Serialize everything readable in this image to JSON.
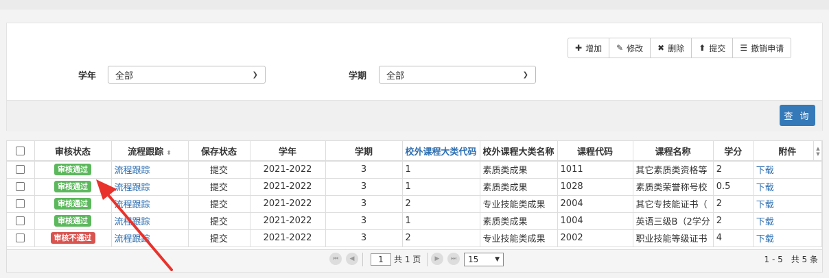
{
  "toolbar": {
    "add": "增加",
    "edit": "修改",
    "delete": "删除",
    "submit": "提交",
    "revoke": "撤销申请"
  },
  "filters": {
    "year_label": "学年",
    "year_value": "全部",
    "term_label": "学期",
    "term_value": "全部",
    "query_button": "查 询"
  },
  "table": {
    "headers": [
      "审核状态",
      "流程跟踪",
      "保存状态",
      "学年",
      "学期",
      "校外课程大类代码",
      "校外课程大类名称",
      "课程代码",
      "课程名称",
      "学分",
      "附件"
    ],
    "rows": [
      {
        "status": "审核通过",
        "status_type": "ok",
        "trace": "流程跟踪",
        "save": "提交",
        "year": "2021-2022",
        "term": "3",
        "cat_code": "1",
        "cat_name": "素质类成果",
        "course_code": "1011",
        "course_name": "其它素质类资格等",
        "credit": "2",
        "attach": "下载"
      },
      {
        "status": "审核通过",
        "status_type": "ok",
        "trace": "流程跟踪",
        "save": "提交",
        "year": "2021-2022",
        "term": "3",
        "cat_code": "1",
        "cat_name": "素质类成果",
        "course_code": "1028",
        "course_name": "素质类荣誉称号校",
        "credit": "0.5",
        "attach": "下载"
      },
      {
        "status": "审核通过",
        "status_type": "ok",
        "trace": "流程跟踪",
        "save": "提交",
        "year": "2021-2022",
        "term": "3",
        "cat_code": "2",
        "cat_name": "专业技能类成果",
        "course_code": "2004",
        "course_name": "其它专技能证书（",
        "credit": "2",
        "attach": "下载"
      },
      {
        "status": "审核通过",
        "status_type": "ok",
        "trace": "流程跟踪",
        "save": "提交",
        "year": "2021-2022",
        "term": "3",
        "cat_code": "1",
        "cat_name": "素质类成果",
        "course_code": "1004",
        "course_name": "英语三级B（2学分",
        "credit": "2",
        "attach": "下载"
      },
      {
        "status": "审核不通过",
        "status_type": "bad",
        "trace": "流程跟踪",
        "save": "提交",
        "year": "2021-2022",
        "term": "3",
        "cat_code": "2",
        "cat_name": "专业技能类成果",
        "course_code": "2002",
        "course_name": "职业技能等级证书",
        "credit": "4",
        "attach": "下载"
      }
    ]
  },
  "pager": {
    "page": "1",
    "total_pages_text": "共 1 页",
    "page_size": "15",
    "info": "1 - 5　共 5 条"
  },
  "colors": {
    "primary": "#3579b8",
    "ok": "#5cb85c",
    "bad": "#d9534f",
    "link": "#2a6db0",
    "annotation_arrow": "#e8322b"
  }
}
